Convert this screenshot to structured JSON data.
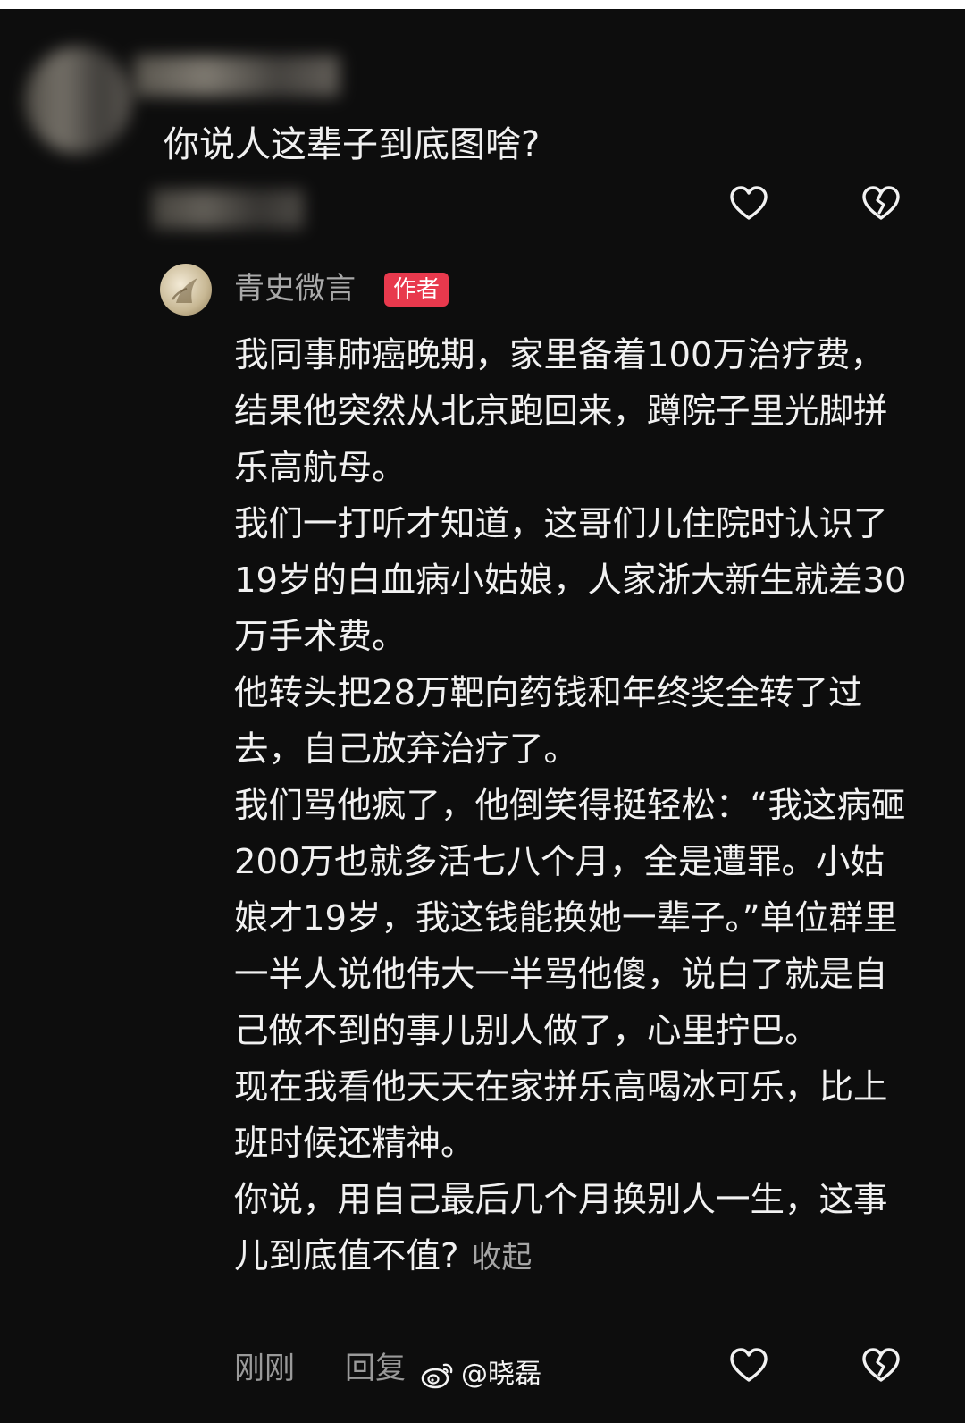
{
  "question": {
    "text": "你说人这辈子到底图啥?"
  },
  "reply": {
    "author_name": "青史微言",
    "author_badge": "作者",
    "paragraphs": [
      "我同事肺癌晚期，家里备着100万治疗费，结果他突然从北京跑回来，蹲院子里光脚拼乐高航母。",
      "我们一打听才知道，这哥们儿住院时认识了19岁的白血病小姑娘，人家浙大新生就差30万手术费。",
      "他转头把28万靶向药钱和年终奖全转了过去，自己放弃治疗了。",
      "我们骂他疯了，他倒笑得挺轻松：“我这病砸200万也就多活七八个月，全是遭罪。小姑娘才19岁，我这钱能换她一辈子。”单位群里一半人说他伟大一半骂他傻，说白了就是自己做不到的事儿别人做了，心里拧巴。",
      "现在我看他天天在家拼乐高喝冰可乐，比上班时候还精神。"
    ],
    "last_paragraph": "你说，用自己最后几个月换别人一生，这事儿到底值不值?",
    "collapse_label": "收起",
    "time": "刚刚",
    "reply_label": "回复"
  },
  "icons": {
    "like": "heart-outline-icon",
    "dislike": "broken-heart-icon",
    "watermark_logo": "weibo-logo-icon"
  },
  "watermark": {
    "text": "@晓磊"
  },
  "colors": {
    "background": "#0d0d0d",
    "text": "#f1f1f1",
    "muted": "#a9a9a9",
    "badge": "#e8394d"
  }
}
